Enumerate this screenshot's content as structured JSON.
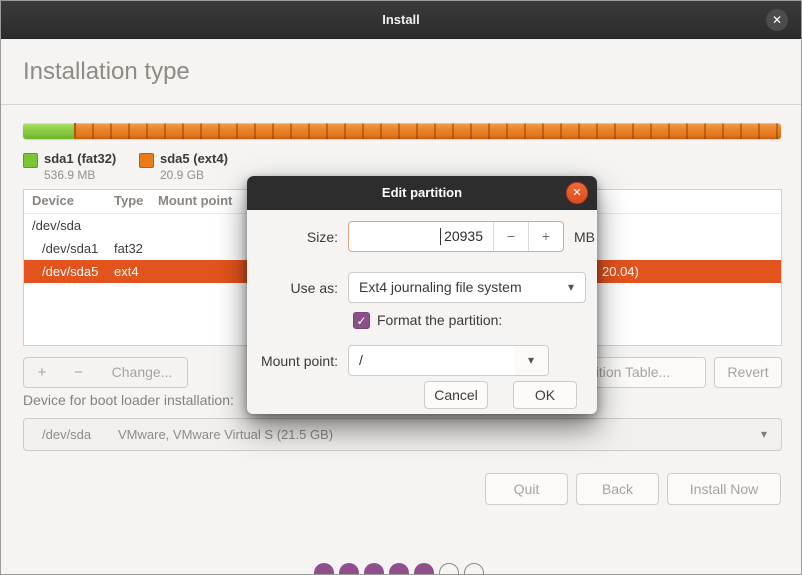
{
  "window": {
    "title": "Install",
    "close_icon": "✕"
  },
  "page": {
    "heading": "Installation type"
  },
  "partition_bar": {
    "legend": [
      {
        "label": "sda1 (fat32)",
        "size": "536.9 MB",
        "color": "#7cc435"
      },
      {
        "label": "sda5 (ext4)",
        "size": "20.9 GB",
        "color": "#e87d17"
      }
    ]
  },
  "table": {
    "columns": {
      "device": "Device",
      "type": "Type",
      "mount_point": "Mount point"
    },
    "rows": [
      {
        "device": "/dev/sda",
        "type": "",
        "tail": ""
      },
      {
        "device": "/dev/sda1",
        "type": "fat32",
        "tail": ""
      },
      {
        "device": "/dev/sda5",
        "type": "ext4",
        "tail": "20.04)"
      }
    ]
  },
  "toolbar": {
    "add": "+",
    "remove": "−",
    "change": "Change...",
    "partition_table": "tition Table...",
    "revert": "Revert"
  },
  "bootloader": {
    "label": "Device for boot loader installation:",
    "device": "/dev/sda",
    "description": "VMware, VMware Virtual S (21.5 GB)",
    "arrow_icon": "▾"
  },
  "footer": {
    "quit": "Quit",
    "back": "Back",
    "install_now": "Install Now"
  },
  "progress_dots": {
    "total": 7,
    "filled": 5,
    "filled_color": "#8f4f8c"
  },
  "dialog": {
    "title": "Edit partition",
    "close_icon": "✕",
    "size": {
      "label": "Size:",
      "value": "20935",
      "minus": "−",
      "plus": "+",
      "unit": "MB"
    },
    "use_as": {
      "label": "Use as:",
      "value": "Ext4 journaling file system",
      "arrow_icon": "▾"
    },
    "format": {
      "label": "Format the partition:",
      "checked": true,
      "check_icon": "✓"
    },
    "mount_point": {
      "label": "Mount point:",
      "value": "/",
      "arrow_icon": "▾"
    },
    "cancel": "Cancel",
    "ok": "OK"
  },
  "colors": {
    "accent_orange": "#e95420",
    "selected_row": "#e3531e",
    "bar_orange": "#e8821e",
    "bar_green": "#7cc435",
    "checkbox_purple": "#8a5189",
    "titlebar": "#2e2e2e"
  }
}
